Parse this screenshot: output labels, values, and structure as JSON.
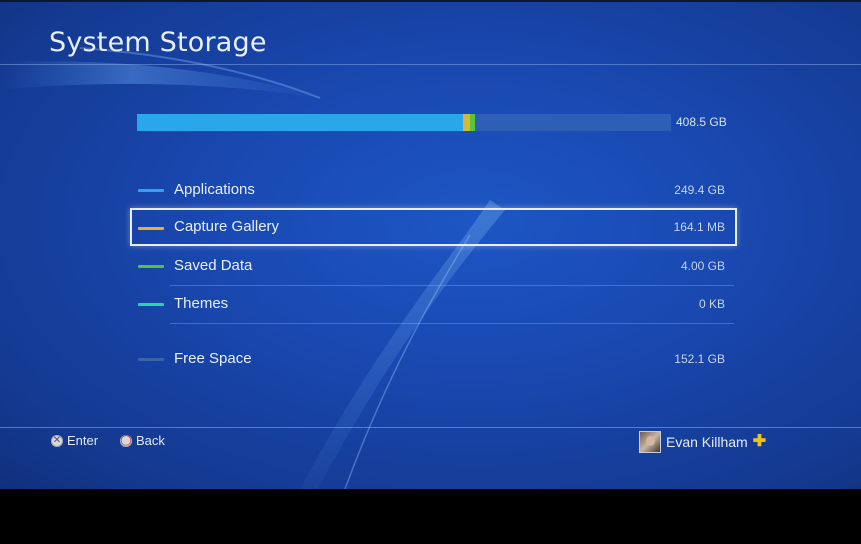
{
  "screen": {
    "title": "System Storage"
  },
  "storage_bar": {
    "total_label": "408.5 GB",
    "segments": [
      {
        "name": "applications",
        "fraction": 0.6105,
        "color": "#29a7ea"
      },
      {
        "name": "capture-gallery",
        "fraction": 0.0004,
        "color": "#f0a835"
      },
      {
        "name": "saved-data",
        "fraction": 0.0098,
        "color": "#c4c233"
      },
      {
        "name": "saved-data-2",
        "fraction": 0.0098,
        "color": "#5ec33a"
      }
    ],
    "track_color": "#2c5fb5"
  },
  "categories": [
    {
      "label": "Applications",
      "size": "249.4 GB",
      "color": "#2aa6ea",
      "selected": false
    },
    {
      "label": "Capture Gallery",
      "size": "164.1 MB",
      "color": "#efaa39",
      "selected": true
    },
    {
      "label": "Saved Data",
      "size": "4.00 GB",
      "color": "#56c23a",
      "selected": false
    },
    {
      "label": "Themes",
      "size": "0 KB",
      "color": "#2fd0b0",
      "selected": false
    },
    {
      "label": "Free Space",
      "size": "152.1 GB",
      "color": "#3a64a8",
      "selected": false
    }
  ],
  "footer": {
    "enter_icon": "cross-button-icon",
    "enter_label": "Enter",
    "back_icon": "circle-button-icon",
    "back_label": "Back",
    "username": "Evan Killham",
    "plus_icon": "playstation-plus-icon",
    "plus_color": "#f2c21c"
  }
}
